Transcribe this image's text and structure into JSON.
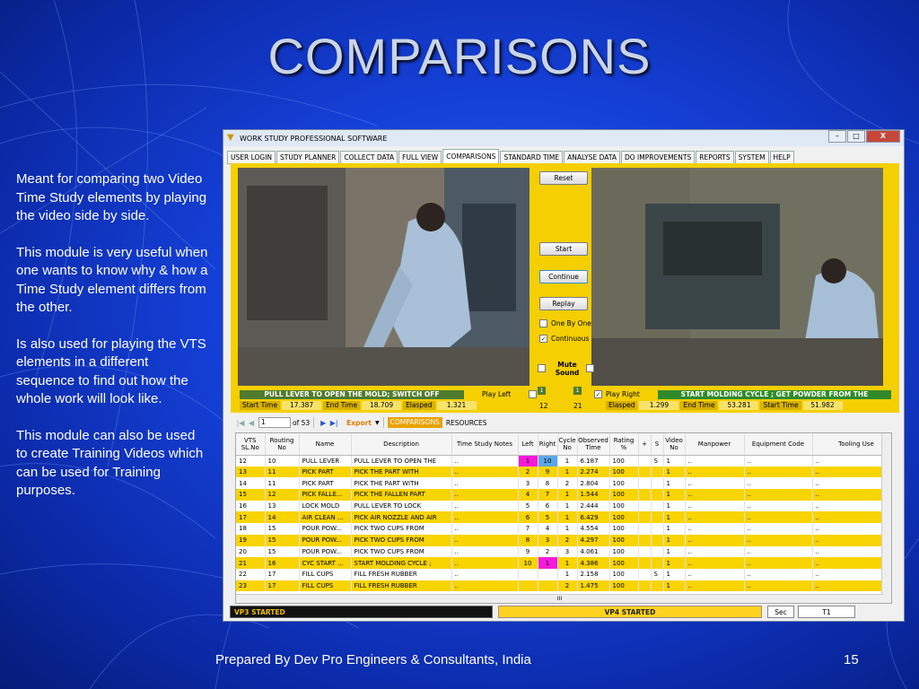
{
  "slide": {
    "title": "COMPARISONS",
    "paragraphs": [
      "Meant for comparing two Video Time Study elements by playing the video side by side.",
      "This module is very useful when one wants to know why & how a Time Study element differs from the other.",
      "Is also used for playing the VTS elements in a different sequence to find out how the whole work will look like.",
      "This module can also be used to create Training Videos which can be used for Training purposes."
    ],
    "footer": "Prepared By Dev Pro Engineers & Consultants, India",
    "page_number": "15"
  },
  "window": {
    "title": "WORK STUDY PROFESSIONAL SOFTWARE",
    "controls": {
      "minimize": "–",
      "maximize": "□",
      "close": "X"
    }
  },
  "tabs": [
    "USER LOGIN",
    "STUDY PLANNER",
    "COLLECT DATA",
    "FULL VIEW",
    "COMPARISONS",
    "STANDARD TIME",
    "ANALYSE DATA",
    "DO IMPROVEMENTS",
    "REPORTS",
    "SYSTEM",
    "HELP"
  ],
  "controls": {
    "reset": "Reset",
    "start": "Start",
    "continue": "Continue",
    "replay": "Replay",
    "one_by_one": "One By One",
    "continuous": "Continuous",
    "mute_line1": "Mute",
    "mute_line2": "Sound"
  },
  "left_player": {
    "element_label": "PULL LEVER TO OPEN THE MOLD; SWITCH OFF",
    "play_label": "Play Left",
    "counter": "12",
    "start_time_label": "Start Time",
    "start_time": "17.387",
    "end_time_label": "End Time",
    "end_time": "18.709",
    "elapsed_label": "Elasped",
    "elapsed": "1.321"
  },
  "right_player": {
    "element_label": "START MOLDING CYCLE ; GET POWDER FROM THE",
    "play_label": "Play Right",
    "counter": "21",
    "elapsed_label": "Elasped",
    "elapsed": "1.299",
    "end_time_label": "End Time",
    "end_time": "53.281",
    "start_time_label": "Start Time",
    "start_time": "51.982"
  },
  "navigator": {
    "page": "1",
    "of": "of 53",
    "export": "Export",
    "comparisons": "COMPARISONS",
    "resources": "RESOURCES"
  },
  "table": {
    "headers": [
      "VTS SL.No",
      "Routing No",
      "Name",
      "Description",
      "Time Study Notes",
      "Left",
      "Right",
      "Cycle No",
      "Observed Time",
      "Rating %",
      "+",
      "S",
      "Video No",
      "Manpower",
      "Equipment Code",
      "Tooling Use"
    ],
    "rows": [
      [
        "12",
        "10",
        "PULL LEVER",
        "PULL LEVER TO OPEN THE",
        "..",
        "1",
        "10",
        "1",
        "6.187",
        "100",
        "",
        "S",
        "1",
        "..",
        "..",
        ".."
      ],
      [
        "13",
        "11",
        "PICK PART",
        "PICK THE PART WITH",
        "..",
        "2",
        "9",
        "1",
        "2.274",
        "100",
        "",
        "",
        "1",
        "..",
        "..",
        ".."
      ],
      [
        "14",
        "11",
        "PICK PART",
        "PICK THE PART WITH",
        "..",
        "3",
        "8",
        "2",
        "2.804",
        "100",
        "",
        "",
        "1",
        "..",
        "..",
        ".."
      ],
      [
        "15",
        "12",
        "PICK FALLE...",
        "PICK THE FALLEN PART",
        "..",
        "4",
        "7",
        "1",
        "1.544",
        "100",
        "",
        "",
        "1",
        "..",
        "..",
        ".."
      ],
      [
        "16",
        "13",
        "LOCK MOLD",
        "PULL LEVER TO LOCK",
        "..",
        "5",
        "6",
        "1",
        "2.444",
        "100",
        "",
        "",
        "1",
        "..",
        "..",
        ".."
      ],
      [
        "17",
        "14",
        "AIR CLEAN ...",
        "PICK AIR NOZZLE AND AIR",
        "..",
        "6",
        "5",
        "1",
        "6.429",
        "100",
        "",
        "",
        "1",
        "..",
        "..",
        ".."
      ],
      [
        "18",
        "15",
        "POUR POW...",
        "PICK TWO CUPS FROM",
        "..",
        "7",
        "4",
        "1",
        "4.554",
        "100",
        "",
        "",
        "1",
        "..",
        "..",
        ".."
      ],
      [
        "19",
        "15",
        "POUR POW...",
        "PICK TWO CUPS FROM",
        "..",
        "8",
        "3",
        "2",
        "4.297",
        "100",
        "",
        "",
        "1",
        "..",
        "..",
        ".."
      ],
      [
        "20",
        "15",
        "POUR POW...",
        "PICK TWO CUPS FROM",
        "..",
        "9",
        "2",
        "3",
        "4.061",
        "100",
        "",
        "",
        "1",
        "..",
        "..",
        ".."
      ],
      [
        "21",
        "16",
        "CYC START ...",
        "START MOLDING CYCLE ;",
        "..",
        "10",
        "1",
        "1",
        "4.386",
        "100",
        "",
        "",
        "1",
        "..",
        "..",
        ".."
      ],
      [
        "22",
        "17",
        "FILL CUPS",
        "FILL FRESH RUBBER",
        "..",
        "",
        "",
        "1",
        "2.158",
        "100",
        "",
        "S",
        "1",
        "..",
        "..",
        ".."
      ],
      [
        "23",
        "17",
        "FILL CUPS",
        "FILL FRESH RUBBER",
        "..",
        "",
        "",
        "2",
        "1.475",
        "100",
        "",
        "",
        "1",
        "..",
        "..",
        ".."
      ]
    ],
    "hscroll_grip": "III"
  },
  "status": {
    "left": "VP3 STARTED",
    "right": "VP4 STARTED",
    "unit": "Sec",
    "field": "T1"
  }
}
